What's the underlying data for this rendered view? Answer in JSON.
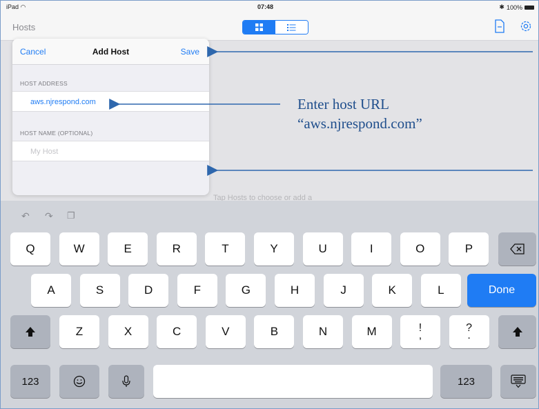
{
  "status_bar": {
    "device": "iPad",
    "time": "07:48",
    "battery": "100%"
  },
  "nav": {
    "hosts_label": "Hosts"
  },
  "popover": {
    "cancel_label": "Cancel",
    "title": "Add Host",
    "save_label": "Save",
    "host_address_label": "HOST ADDRESS",
    "host_address_value": "aws.njrespond.com",
    "host_name_label": "HOST NAME (OPTIONAL)",
    "host_name_placeholder": "My Host"
  },
  "background_hint": "Tap Hosts to choose or add a",
  "annotation": {
    "line1": "Enter host URL",
    "line2": "“aws.njrespond.com”"
  },
  "keyboard": {
    "row1": [
      "Q",
      "W",
      "E",
      "R",
      "T",
      "Y",
      "U",
      "I",
      "O",
      "P"
    ],
    "row2": [
      "A",
      "S",
      "D",
      "F",
      "G",
      "H",
      "J",
      "K",
      "L"
    ],
    "row3": [
      "Z",
      "X",
      "C",
      "V",
      "B",
      "N",
      "M"
    ],
    "row3_punct": [
      {
        "top": "!",
        "bottom": ","
      },
      {
        "top": "?",
        "bottom": "."
      }
    ],
    "done_label": "Done",
    "numbers_label": "123"
  },
  "colors": {
    "accent": "#1f7cf4",
    "annotation": "#1f4e8c",
    "keyboard_bg": "#d1d4da"
  },
  "icons": [
    "wifi-icon",
    "grid-icon",
    "list-icon",
    "document-icon",
    "gear-icon",
    "undo-icon",
    "redo-icon",
    "clipboard-icon",
    "backspace-icon",
    "shift-icon",
    "emoji-icon",
    "microphone-icon",
    "keyboard-dismiss-icon"
  ]
}
